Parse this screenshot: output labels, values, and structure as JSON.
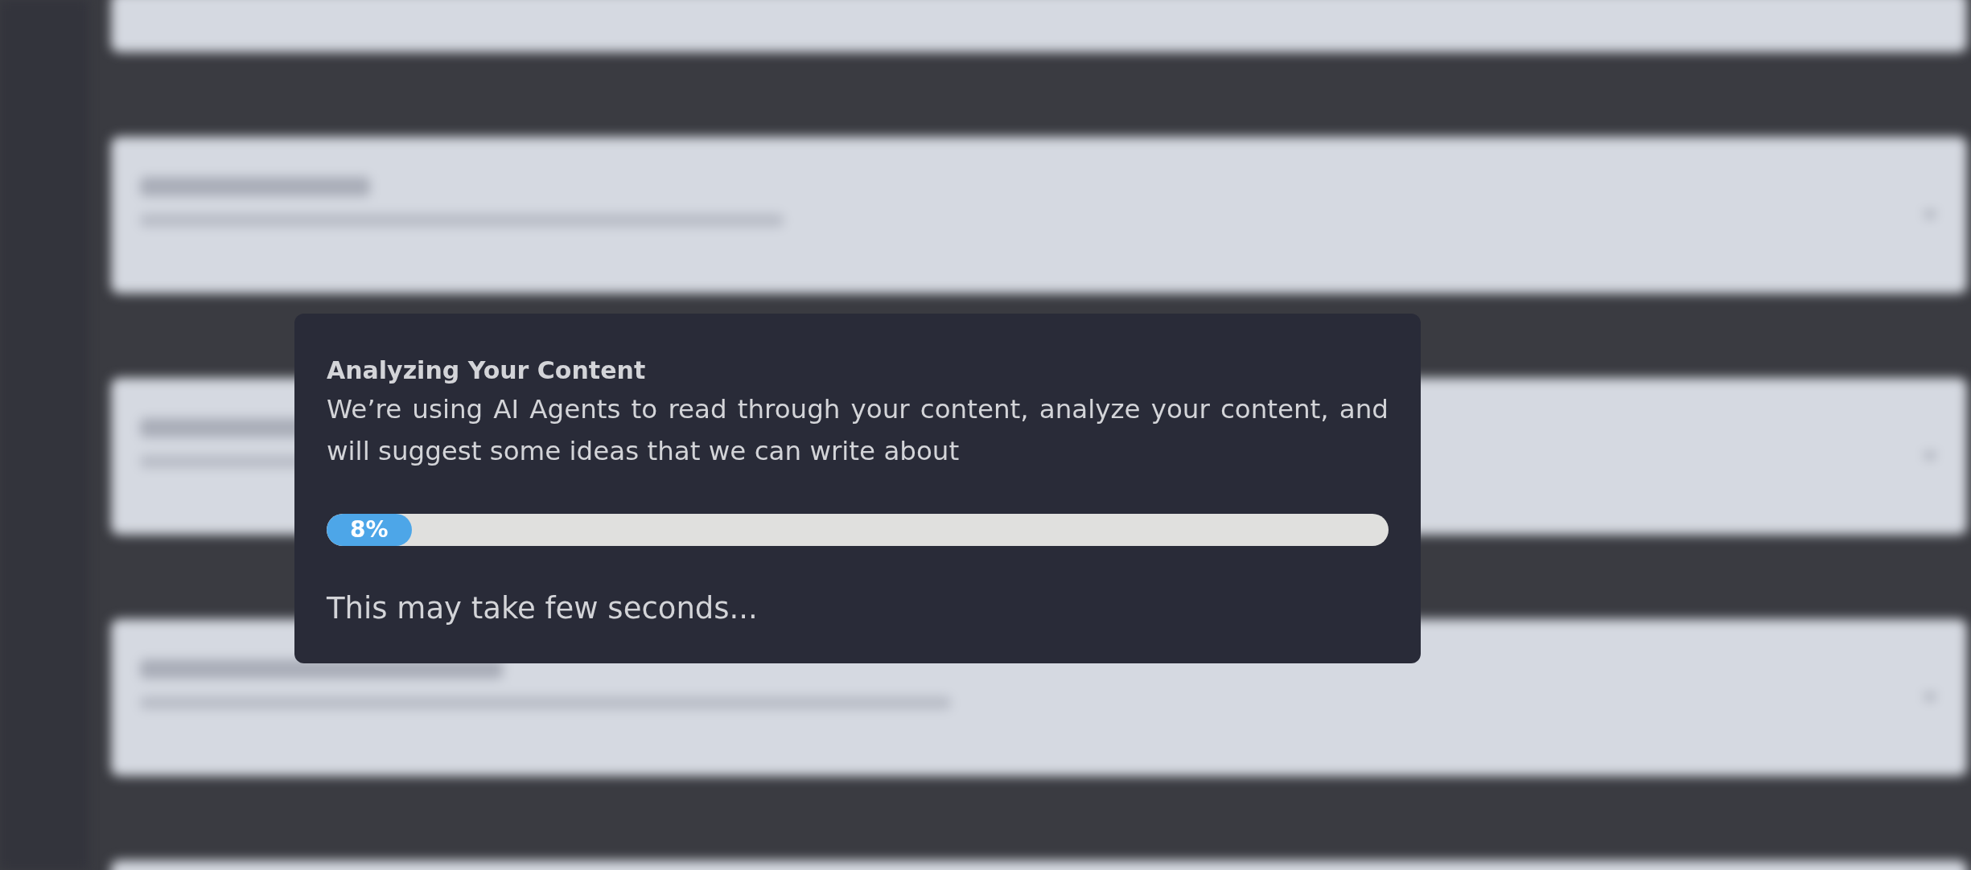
{
  "dialog": {
    "title": "Analyzing Your Content",
    "message": "We’re using AI Agents to read through your content, analyze your content, and will suggest some ideas that we can write about",
    "progress": {
      "level": 0.08,
      "label": "8%"
    },
    "note": "This may take few seconds..."
  }
}
